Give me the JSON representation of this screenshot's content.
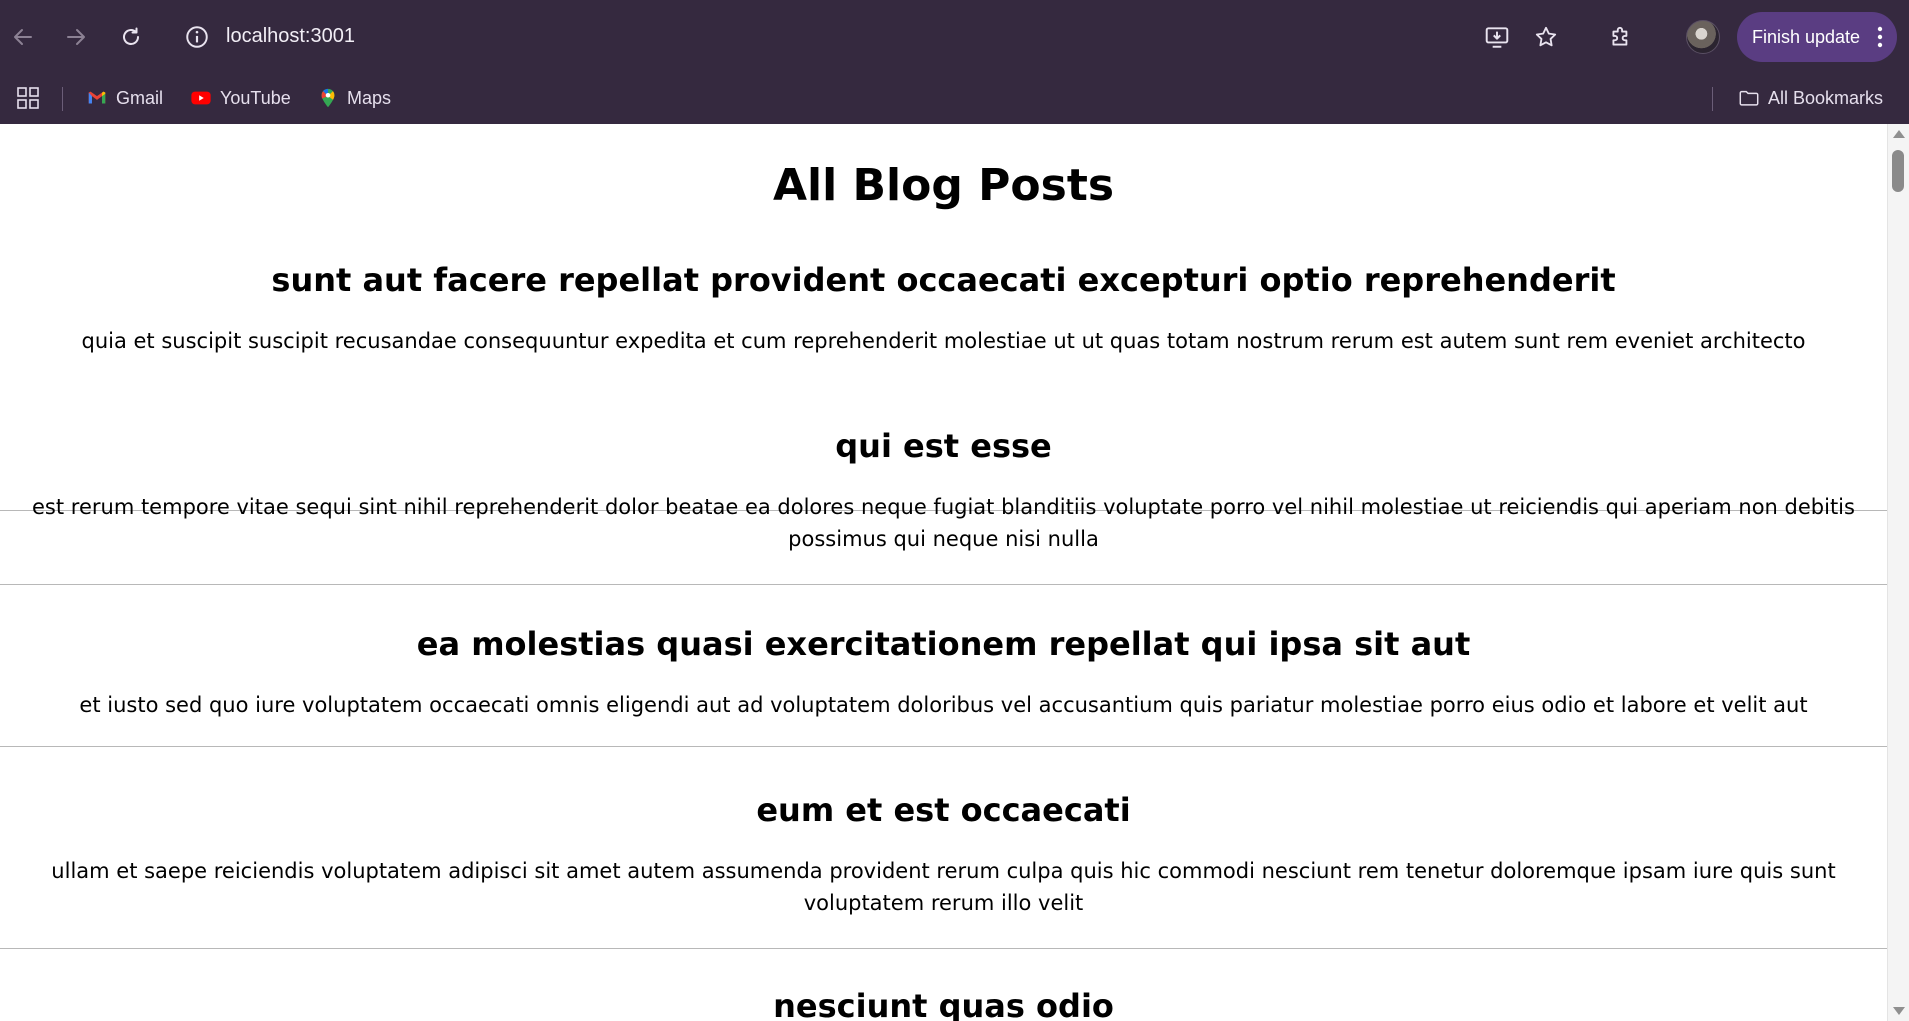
{
  "browser": {
    "url": "localhost:3001",
    "finish_update_label": "Finish update",
    "icons": {
      "back": "back-arrow-icon",
      "forward": "forward-arrow-icon",
      "reload": "reload-icon",
      "site_info": "info-icon",
      "install": "install-app-icon",
      "bookmark_star": "star-icon",
      "extensions": "puzzle-icon",
      "profile": "avatar",
      "menu": "kebab-menu-icon"
    },
    "accent_color": "#5a3d82",
    "frame_color": "#35293f"
  },
  "bookmarks": {
    "items": [
      {
        "label": "Gmail",
        "icon": "gmail-icon"
      },
      {
        "label": "YouTube",
        "icon": "youtube-icon"
      },
      {
        "label": "Maps",
        "icon": "maps-icon"
      }
    ],
    "all_bookmarks_label": "All Bookmarks"
  },
  "page": {
    "title": "All Blog Posts",
    "posts": [
      {
        "title": "sunt aut facere repellat provident occaecati excepturi optio reprehenderit",
        "body": "quia et suscipit suscipit recusandae consequuntur expedita et cum reprehenderit molestiae ut ut quas totam nostrum rerum est autem sunt rem eveniet architecto"
      },
      {
        "title": "qui est esse",
        "body": "est rerum tempore vitae sequi sint nihil reprehenderit dolor beatae ea dolores neque fugiat blanditiis voluptate porro vel nihil molestiae ut reiciendis qui aperiam non debitis possimus qui neque nisi nulla"
      },
      {
        "title": "ea molestias quasi exercitationem repellat qui ipsa sit aut",
        "body": "et iusto sed quo iure voluptatem occaecati omnis eligendi aut ad voluptatem doloribus vel accusantium quis pariatur molestiae porro eius odio et labore et velit aut"
      },
      {
        "title": "eum et est occaecati",
        "body": "ullam et saepe reiciendis voluptatem adipisci sit amet autem assumenda provident rerum culpa quis hic commodi nesciunt rem tenetur doloremque ipsam iure quis sunt voluptatem rerum illo velit"
      },
      {
        "title": "nesciunt quas odio",
        "body": ""
      }
    ]
  }
}
